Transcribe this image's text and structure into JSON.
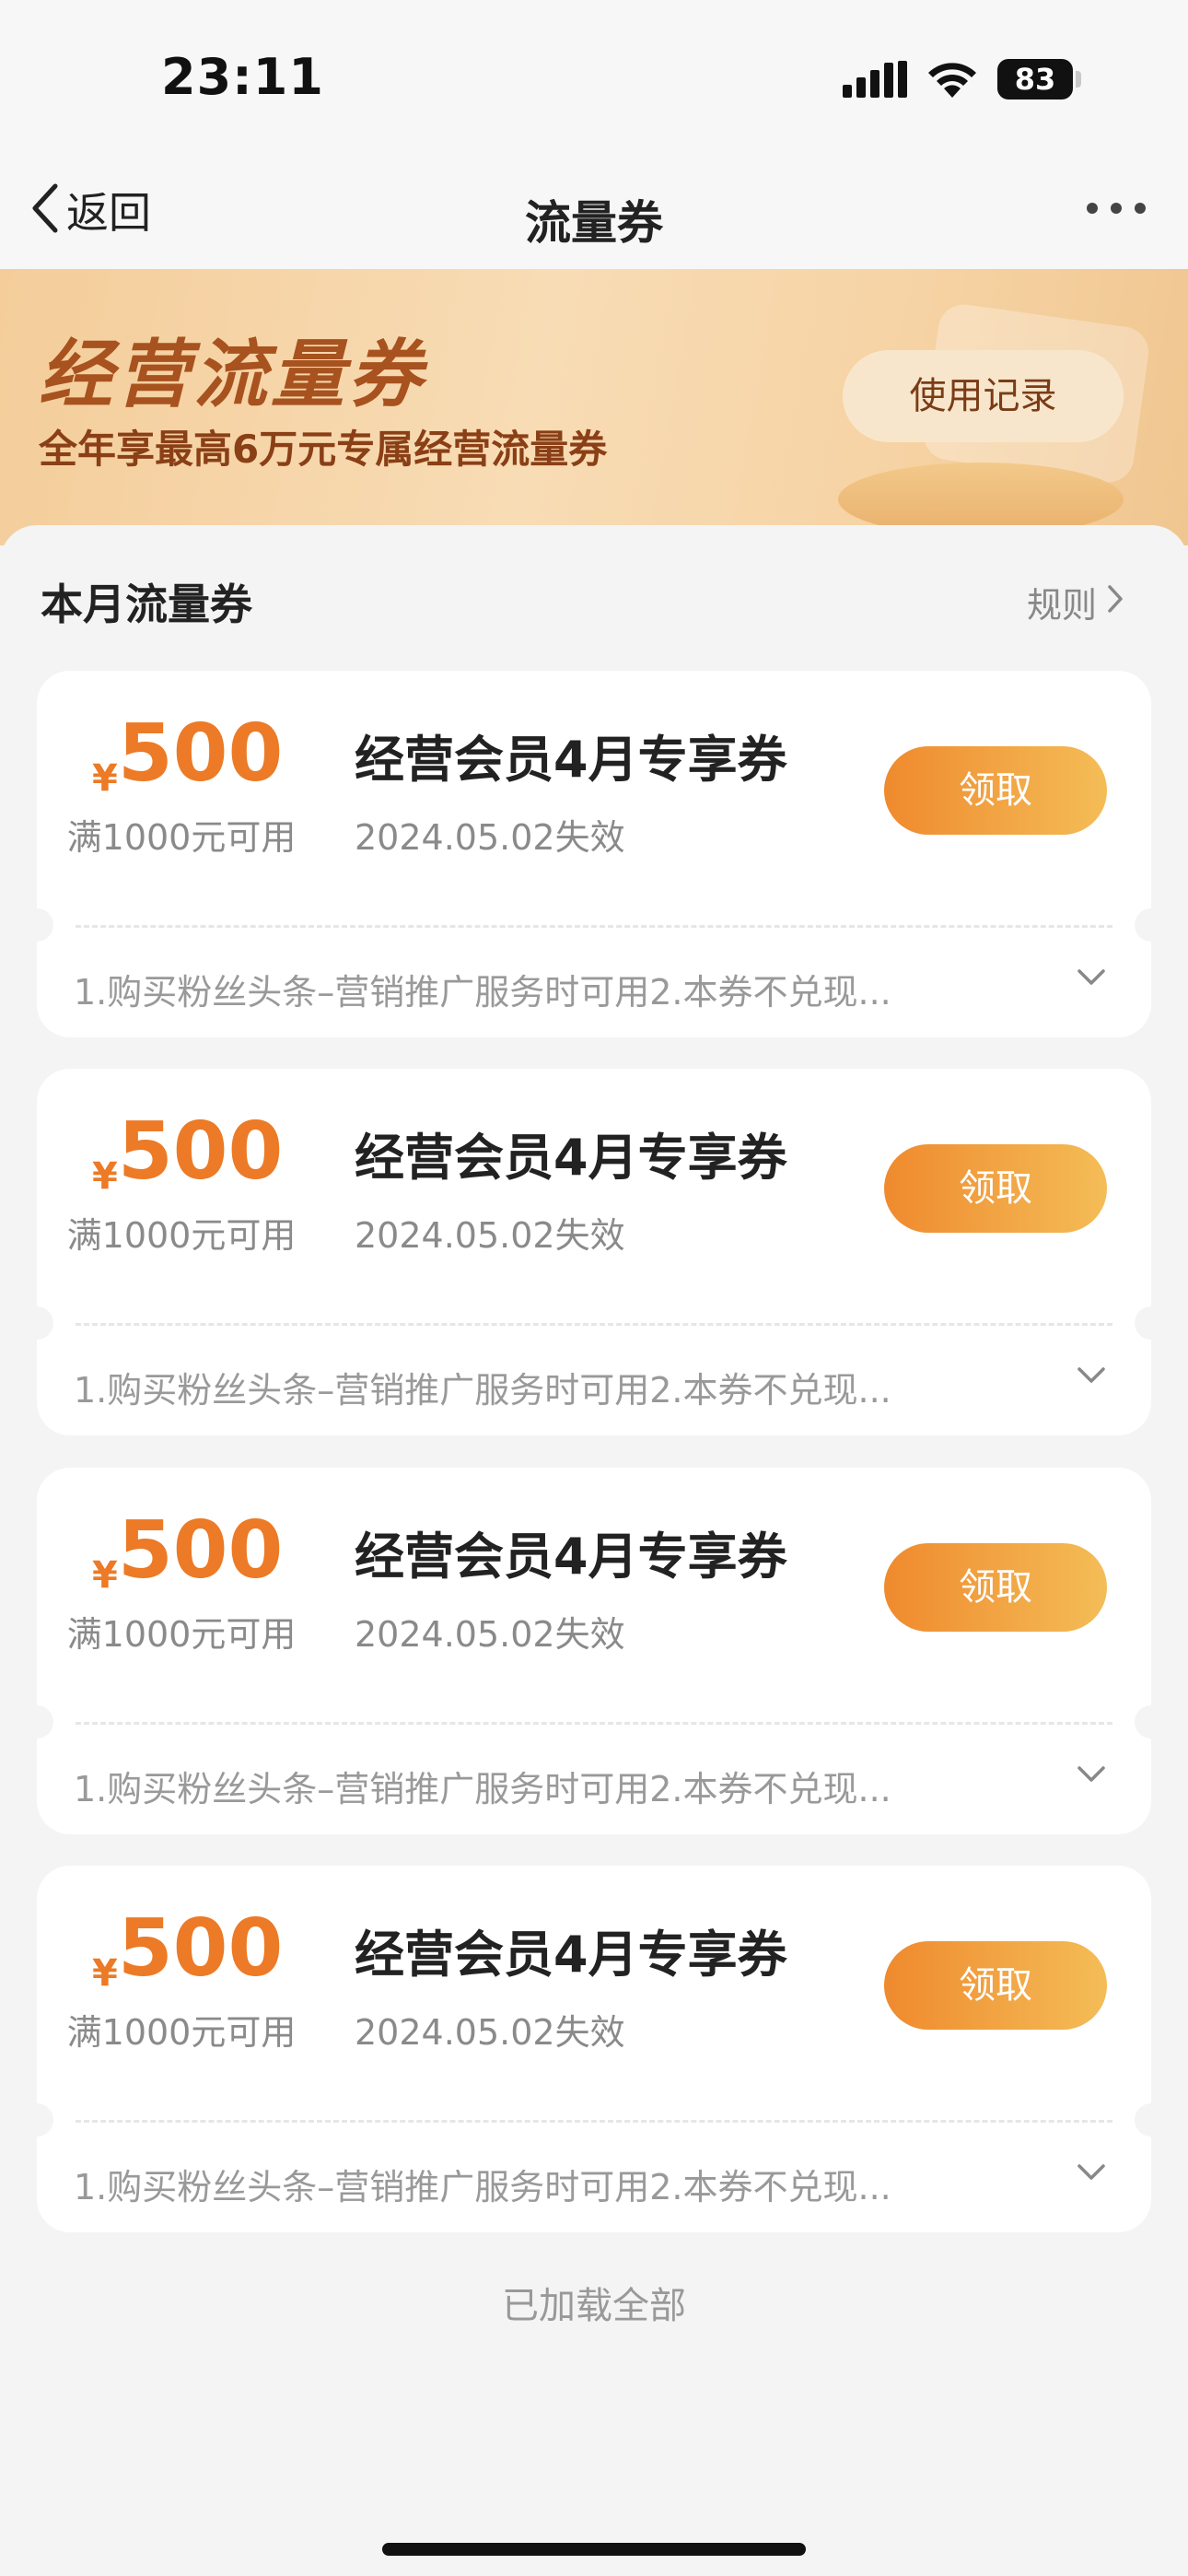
{
  "status": {
    "time": "23:11",
    "battery": "83"
  },
  "nav": {
    "back_label": "返回",
    "title": "流量券"
  },
  "banner": {
    "title": "经营流量券",
    "subtitle": "全年享最高6万元专属经营流量券",
    "record_button": "使用记录"
  },
  "section": {
    "title": "本月流量券",
    "rules_label": "规则"
  },
  "coupons": [
    {
      "currency": "¥",
      "amount": "500",
      "condition": "满1000元可用",
      "name": "经营会员4月专享券",
      "expiry": "2024.05.02失效",
      "claim": "领取",
      "desc": "1.购买粉丝头条–营销推广服务时可用2.本券不兑现..."
    },
    {
      "currency": "¥",
      "amount": "500",
      "condition": "满1000元可用",
      "name": "经营会员4月专享券",
      "expiry": "2024.05.02失效",
      "claim": "领取",
      "desc": "1.购买粉丝头条–营销推广服务时可用2.本券不兑现..."
    },
    {
      "currency": "¥",
      "amount": "500",
      "condition": "满1000元可用",
      "name": "经营会员4月专享券",
      "expiry": "2024.05.02失效",
      "claim": "领取",
      "desc": "1.购买粉丝头条–营销推广服务时可用2.本券不兑现..."
    },
    {
      "currency": "¥",
      "amount": "500",
      "condition": "满1000元可用",
      "name": "经营会员4月专享券",
      "expiry": "2024.05.02失效",
      "claim": "领取",
      "desc": "1.购买粉丝头条–营销推广服务时可用2.本券不兑现..."
    }
  ],
  "footer": {
    "loaded_text": "已加载全部"
  },
  "colors": {
    "accent": "#ec7a26",
    "button_start": "#ef8a2e",
    "button_end": "#f4bd57",
    "banner": "#f6d3a4"
  },
  "icons": [
    "back-chevron-icon",
    "more-icon",
    "signal-icon",
    "wifi-icon",
    "battery-icon",
    "chevron-right-icon",
    "chevron-down-icon"
  ]
}
